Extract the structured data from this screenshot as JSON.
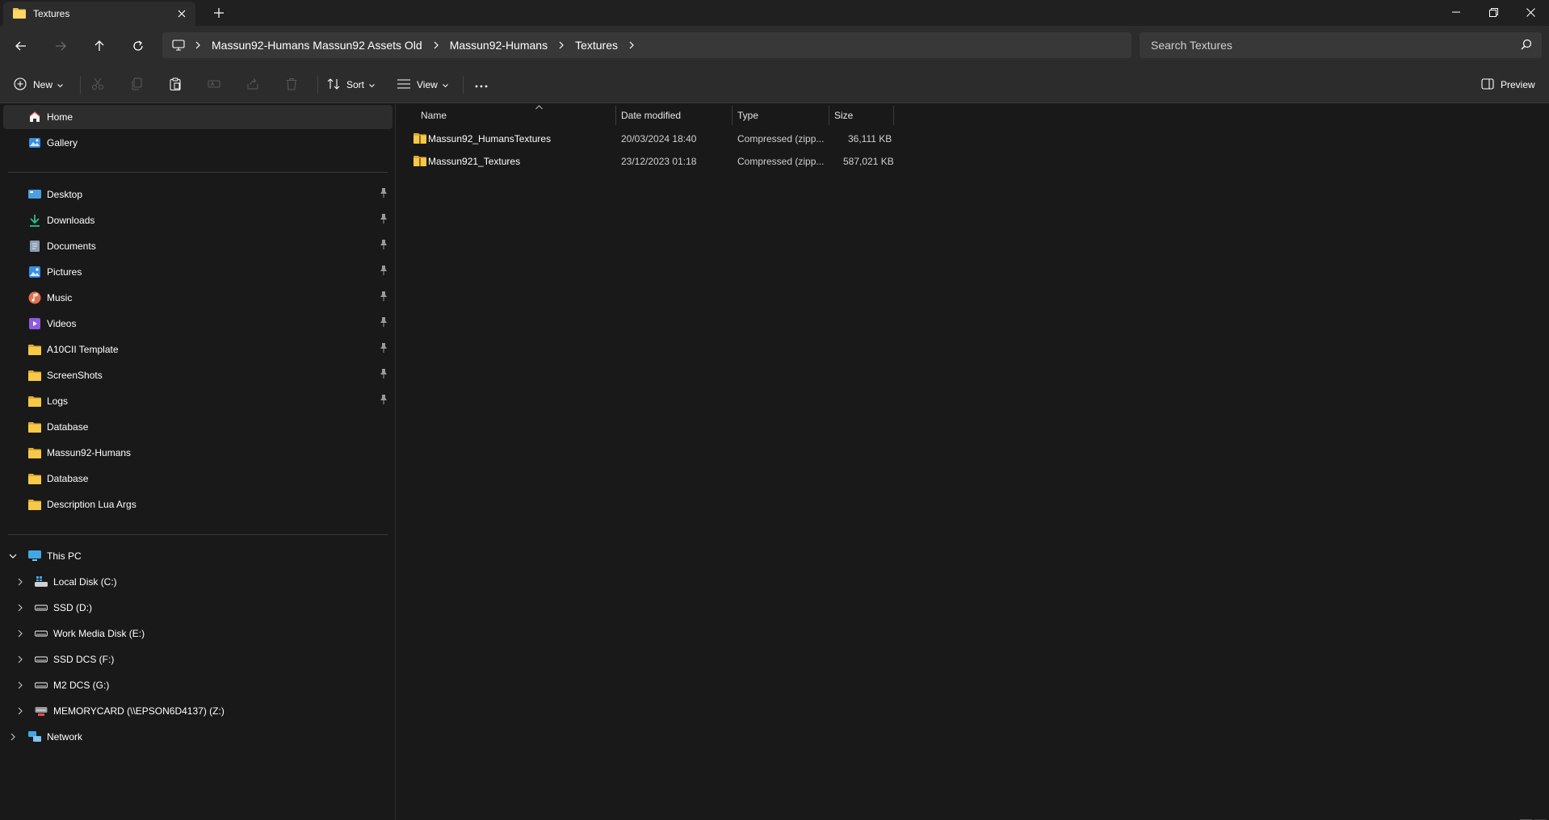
{
  "window": {
    "tab_title": "Textures",
    "controls": [
      "minimize",
      "maximize",
      "close"
    ]
  },
  "address": {
    "breadcrumbs": [
      "Massun92-Humans Massun92 Assets Old",
      "Massun92-Humans",
      "Textures"
    ],
    "search_placeholder": "Search Textures"
  },
  "toolbar": {
    "new_label": "New",
    "sort_label": "Sort",
    "view_label": "View",
    "preview_label": "Preview"
  },
  "sidebar": {
    "top": [
      {
        "label": "Home",
        "icon": "home-icon"
      },
      {
        "label": "Gallery",
        "icon": "gallery-icon"
      }
    ],
    "quick_access": [
      {
        "label": "Desktop",
        "icon": "desktop-icon",
        "pinned": true
      },
      {
        "label": "Downloads",
        "icon": "download-icon",
        "pinned": true
      },
      {
        "label": "Documents",
        "icon": "documents-icon",
        "pinned": true
      },
      {
        "label": "Pictures",
        "icon": "pictures-icon",
        "pinned": true
      },
      {
        "label": "Music",
        "icon": "music-icon",
        "pinned": true
      },
      {
        "label": "Videos",
        "icon": "videos-icon",
        "pinned": true
      },
      {
        "label": "A10CII Template",
        "icon": "folder-icon",
        "pinned": true
      },
      {
        "label": "ScreenShots",
        "icon": "folder-icon",
        "pinned": true
      },
      {
        "label": "Logs",
        "icon": "folder-icon",
        "pinned": true
      },
      {
        "label": "Database",
        "icon": "folder-icon",
        "pinned": false
      },
      {
        "label": "Massun92-Humans",
        "icon": "folder-icon",
        "pinned": false
      },
      {
        "label": "Database",
        "icon": "folder-icon",
        "pinned": false
      },
      {
        "label": "Description Lua Args",
        "icon": "folder-icon",
        "pinned": false
      }
    ],
    "this_pc": {
      "label": "This PC",
      "icon": "pc-icon"
    },
    "drives": [
      {
        "label": "Local Disk (C:)",
        "icon": "system-drive-icon"
      },
      {
        "label": "SSD (D:)",
        "icon": "drive-icon"
      },
      {
        "label": "Work Media Disk (E:)",
        "icon": "drive-icon"
      },
      {
        "label": "SSD DCS (F:)",
        "icon": "drive-icon"
      },
      {
        "label": "M2 DCS (G:)",
        "icon": "drive-icon"
      },
      {
        "label": "MEMORYCARD (\\\\EPSON6D4137) (Z:)",
        "icon": "network-drive-icon"
      }
    ],
    "network": {
      "label": "Network",
      "icon": "network-icon"
    }
  },
  "files": {
    "columns": [
      "Name",
      "Date modified",
      "Type",
      "Size"
    ],
    "rows": [
      {
        "name": "Massun92_HumansTextures",
        "date": "20/03/2024 18:40",
        "type": "Compressed (zipp...",
        "size": "36,111 KB"
      },
      {
        "name": "Massun921_Textures",
        "date": "23/12/2023 01:18",
        "type": "Compressed (zipp...",
        "size": "587,021 KB"
      }
    ]
  },
  "colors": {
    "background": "#191919",
    "chrome": "#2c2c2c",
    "folder": "#f2c14e",
    "accent": "#4cc2ff"
  }
}
